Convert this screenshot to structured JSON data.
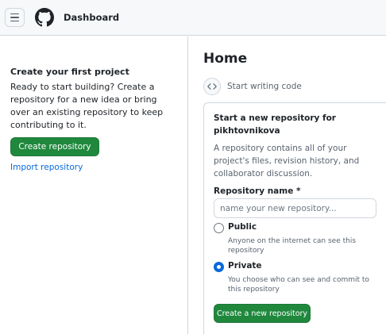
{
  "header": {
    "title": "Dashboard",
    "menu_icon": "hamburger-menu-icon",
    "logo_icon": "github-logo-icon"
  },
  "sidebar": {
    "heading": "Create your first project",
    "text": "Ready to start building? Create a repository for a new idea or bring over an existing repository to keep contributing to it.",
    "create_button": "Create repository",
    "import_link": "Import repository"
  },
  "main": {
    "title": "Home",
    "start_label": "Start writing code",
    "code_icon": "code-icon",
    "card": {
      "heading": "Start a new repository for pikhtovnikova",
      "description": "A repository contains all of your project's files, revision history, and collaborator discussion.",
      "repo_name_label": "Repository name *",
      "repo_name_placeholder": "name your new repository...",
      "repo_name_value": "",
      "public_label": "Public",
      "public_desc": "Anyone on the internet can see this repository",
      "private_label": "Private",
      "private_desc": "You choose who can see and commit to this repository",
      "selected_visibility": "Private",
      "create_button": "Create a new repository"
    }
  },
  "colors": {
    "accent_green": "#1f883d",
    "link_blue": "#0969da",
    "border": "#d0d7de",
    "header_bg": "#f6f8fa",
    "muted_text": "#59636e"
  }
}
